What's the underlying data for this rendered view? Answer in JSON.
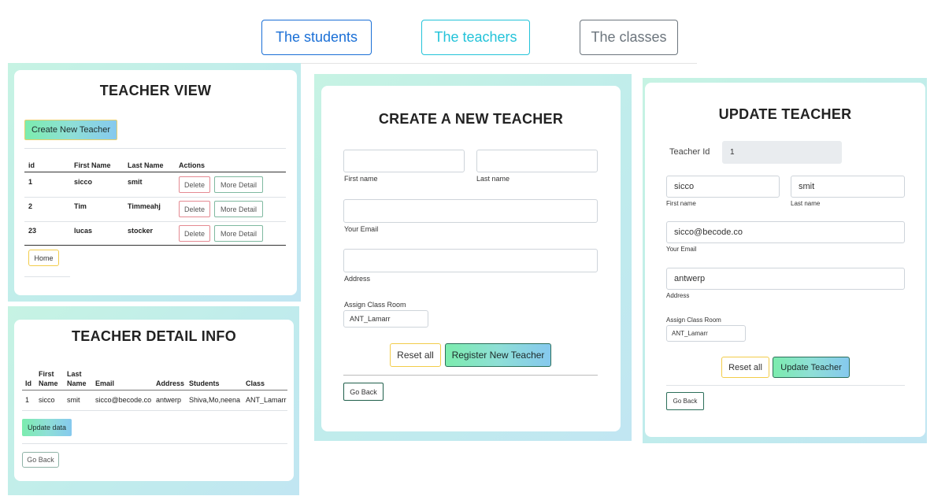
{
  "nav": {
    "students": "The students",
    "teachers": "The teachers",
    "classes": "The classes"
  },
  "teacher_view": {
    "title": "TEACHER VIEW",
    "create_button": "Create New Teacher",
    "columns": [
      "id",
      "First Name",
      "Last Name",
      "Actions"
    ],
    "rows": [
      {
        "id": "1",
        "first": "sicco",
        "last": "smit"
      },
      {
        "id": "2",
        "first": "Tim",
        "last": "Timmeahj"
      },
      {
        "id": "23",
        "first": "lucas",
        "last": "stocker"
      }
    ],
    "delete_label": "Delete",
    "more_label": "More Detail",
    "home_button": "Home"
  },
  "detail_info": {
    "title": "TEACHER DETAIL INFO",
    "columns": {
      "id": "Id",
      "first_1": "First",
      "first_2": "Name",
      "last_1": "Last",
      "last_2": "Name",
      "email": "Email",
      "address": "Address",
      "students": "Students",
      "class": "Class"
    },
    "row": {
      "id": "1",
      "first": "sicco",
      "last": "smit",
      "email": "sicco@becode.co",
      "address": "antwerp",
      "students": "Shiva,Mo,neena",
      "class": "ANT_Lamarr"
    },
    "update_button": "Update data",
    "back_button": "Go Back"
  },
  "create_teacher": {
    "title": "CREATE A NEW TEACHER",
    "first_label": "First name",
    "last_label": "Last name",
    "email_label": "Your Email",
    "address_label": "Address",
    "class_label": "Assign Class Room",
    "class_value": "ANT_Lamarr",
    "reset_button": "Reset all",
    "register_button": "Register New Teacher",
    "back_button": "Go Back"
  },
  "update_teacher": {
    "title": "UPDATE TEACHER",
    "id_label": "Teacher Id",
    "id_value": "1",
    "first_value": "sicco",
    "first_label": "First name",
    "last_value": "smit",
    "last_label": "Last name",
    "email_value": "sicco@becode.co",
    "email_label": "Your Email",
    "address_value": "antwerp",
    "address_label": "Address",
    "class_label": "Assign Class Room",
    "class_value": "ANT_Lamarr",
    "reset_button": "Reset all",
    "update_button": "Update Teacher",
    "back_button": "Go Back"
  },
  "colors": {
    "students": "#1a6fd6",
    "teachers": "#23c3d9",
    "classes": "#6c757d"
  }
}
